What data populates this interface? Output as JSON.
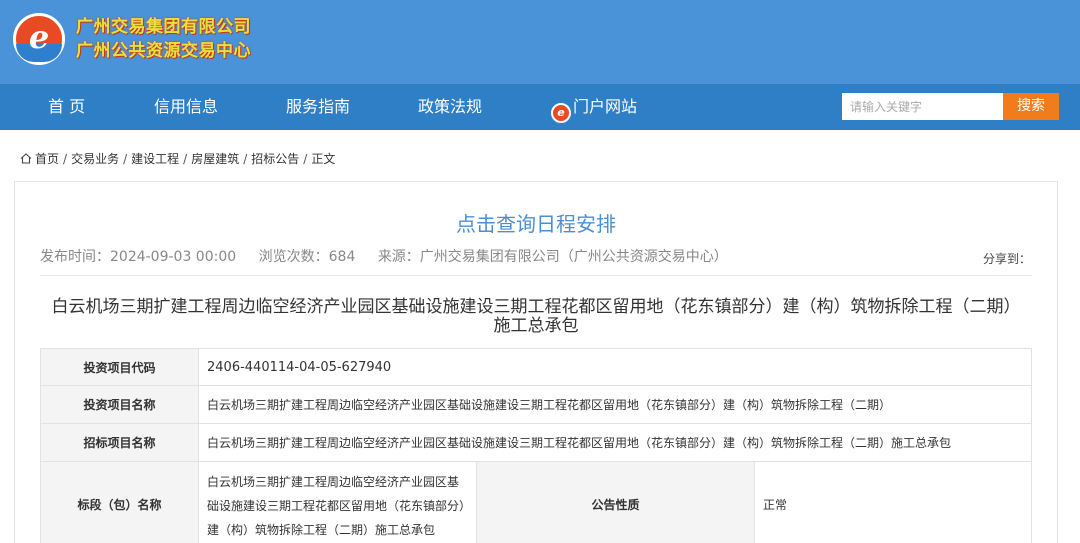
{
  "header": {
    "logo_letter": "e",
    "org_name_1": "广州交易集团有限公司",
    "org_name_2": "广州公共资源交易中心"
  },
  "nav": {
    "items": [
      "首 页",
      "信用信息",
      "服务指南",
      "政策法规"
    ],
    "portal_label": "门户网站",
    "portal_icon_letter": "e",
    "search_placeholder": "请输入关键字",
    "search_button": "搜索"
  },
  "breadcrumb": [
    "首页",
    "交易业务",
    "建设工程",
    "房屋建筑",
    "招标公告",
    "正文"
  ],
  "breadcrumb_sep": "/",
  "page": {
    "schedule_link": "点击查询日程安排",
    "publish_time": "发布时间：2024-09-03 00:00",
    "view_count": "浏览次数：684",
    "source": "来源：广州交易集团有限公司（广州公共资源交易中心）",
    "share_label": "分享到：",
    "announcement_title": "白云机场三期扩建工程周边临空经济产业园区基础设施建设三期工程花都区留用地（花东镇部分）建（构）筑物拆除工程（二期）施工总承包"
  },
  "table": {
    "rows": [
      {
        "label": "投资项目代码",
        "value": "2406-440114-04-05-627940"
      },
      {
        "label": "投资项目名称",
        "value": "白云机场三期扩建工程周边临空经济产业园区基础设施建设三期工程花都区留用地（花东镇部分）建（构）筑物拆除工程（二期）"
      },
      {
        "label": "招标项目名称",
        "value": "白云机场三期扩建工程周边临空经济产业园区基础设施建设三期工程花都区留用地（花东镇部分）建（构）筑物拆除工程（二期）施工总承包"
      }
    ],
    "section_label": "标段（包）名称",
    "section_value": "白云机场三期扩建工程周边临空经济产业园区基础设施建设三期工程花都区留用地（花东镇部分）建（构）筑物拆除工程（二期）施工总承包",
    "nature_label": "公告性质",
    "nature_value": "正常"
  },
  "colors": {
    "header_bg": "#4b93d8",
    "nav_bg": "#2f7fc6",
    "search_button_bg": "#f07c1c",
    "link_blue": "#4b8fd2",
    "logo_red": "#e84a23",
    "org_name_yellow": "#e8e040"
  }
}
